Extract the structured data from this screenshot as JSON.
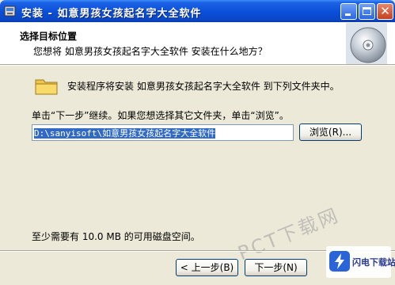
{
  "window": {
    "title": "安装 - 如意男孩女孩起名字大全软件"
  },
  "header": {
    "title": "选择目标位置",
    "subtitle": "您想将 如意男孩女孩起名字大全软件 安装在什么地方？"
  },
  "body": {
    "info": "安装程序将安装 如意男孩女孩起名字大全软件 到下列文件夹中。",
    "instruction": "单击“下一步”继续。如果您想选择其它文件夹，单击“浏览”。",
    "path_value": "D:\\sanyisoft\\如意男孩女孩起名字大全软件",
    "browse_label": "浏览(R)...",
    "disk_space": "至少需要有 10.0 MB 的可用磁盘空间。"
  },
  "footer": {
    "back_label": "< 上一步(B)",
    "next_label": "下一步(N)"
  },
  "watermark": {
    "text": "PCT下载网",
    "badge_name": "闪电下载站"
  },
  "colors": {
    "titlebar": "#0a4fd8",
    "selection": "#316ac5",
    "dialog_bg": "#ece9d8"
  },
  "icons": [
    "app-setup-icon",
    "minimize-icon",
    "maximize-icon",
    "close-icon",
    "disc-icon",
    "folder-icon",
    "lightning-logo-icon"
  ]
}
